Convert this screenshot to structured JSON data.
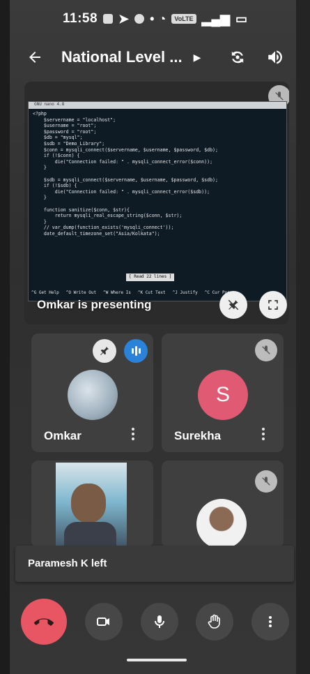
{
  "status": {
    "time": "11:58",
    "network_badge": "VoLTE"
  },
  "appbar": {
    "back_icon": "back-arrow-icon",
    "title": "National Level ..."
  },
  "presentation": {
    "presenter_label": "Omkar is presenting",
    "code_title": "GNU nano 4.8",
    "code_lines": [
      "<?php",
      "    $servername = \"localhost\";",
      "    $username = \"root\";",
      "    $password = \"root\";",
      "    $db = \"mysql\";",
      "    $sdb = \"Demo_Library\";",
      "    $conn = mysqli_connect($servername, $username, $password, $db);",
      "    if (!$conn) {",
      "        die(\"Connection failed: \" . mysqli_connect_error($conn));",
      "    }",
      "",
      "    $sdb = mysqli_connect($servername, $username, $password, $sdb);",
      "    if (!$sdb) {",
      "        die(\"Connection failed: \" . mysqli_connect_error($sdb));",
      "    }",
      "",
      "    function sanitize($conn, $str){",
      "        return mysqli_real_escape_string($conn, $str);",
      "    }",
      "    // var_dump(function_exists('mysqli_connect'));",
      "    date_default_timezone_set(\"Asia/Kolkata\");"
    ],
    "code_status": "[ Read 22 lines ]",
    "code_keys": [
      "^G Get Help",
      "^O Write Out",
      "^W Where Is",
      "^K Cut Text",
      "^J Justify",
      "^C Cur Pos"
    ]
  },
  "participants": [
    {
      "name": "Omkar",
      "initial": ""
    },
    {
      "name": "Surekha",
      "initial": "S"
    },
    {
      "name": "",
      "initial": ""
    },
    {
      "name": "",
      "initial": ""
    }
  ],
  "toast": {
    "text": "Paramesh K left"
  },
  "colors": {
    "end_call": "#e85563",
    "surekha_avatar": "#e05a73",
    "speaking": "#2b82d9"
  }
}
